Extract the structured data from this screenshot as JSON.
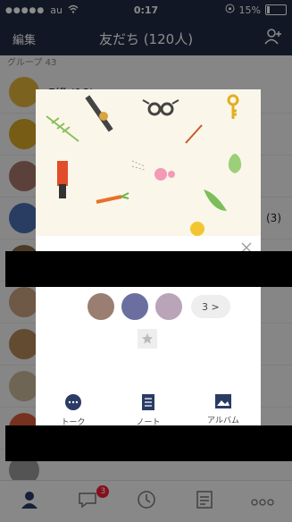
{
  "status": {
    "carrier": "au",
    "time": "0:17",
    "battery": "15%",
    "battery_level": 0.15
  },
  "navbar": {
    "edit": "編集",
    "title": "友だち (120人)"
  },
  "list": {
    "section_header": "グループ 43",
    "rows": [
      {
        "name": "F組 (18)",
        "count": ""
      },
      {
        "name": "",
        "count": ""
      },
      {
        "name": "",
        "count": ""
      },
      {
        "name": "",
        "count": "(3)"
      },
      {
        "name": "",
        "count": ""
      },
      {
        "name": "",
        "count": ""
      },
      {
        "name": "",
        "count": ""
      },
      {
        "name": "",
        "count": ""
      },
      {
        "name": "",
        "count": ""
      },
      {
        "name": "",
        "count": ""
      }
    ]
  },
  "card": {
    "more_label": "3 >",
    "actions": [
      {
        "label": "トーク",
        "icon": "chat-bubble-icon"
      },
      {
        "label": "ノート",
        "icon": "note-icon"
      },
      {
        "label": "アルバム",
        "icon": "album-icon"
      }
    ]
  },
  "tabbar": {
    "badge": "3",
    "tabs": [
      {
        "icon": "friends-icon"
      },
      {
        "icon": "chats-icon"
      },
      {
        "icon": "timeline-icon"
      },
      {
        "icon": "news-icon"
      },
      {
        "icon": "more-icon"
      }
    ]
  },
  "colors": {
    "nav": "#1f2a44",
    "accent": "#2a3b66",
    "badge": "#e23"
  }
}
